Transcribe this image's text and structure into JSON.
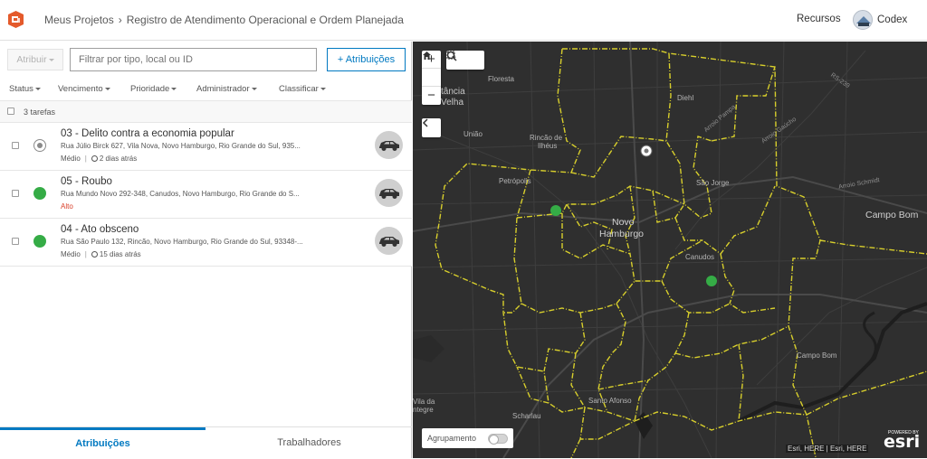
{
  "header": {
    "logo": "workforce-logo-icon",
    "breadcrumb_home": "Meus Projetos",
    "breadcrumb_sep": "›",
    "breadcrumb_current": "Registro de Atendimento Operacional e Ordem Planejada",
    "resources_label": "Recursos",
    "user_name": "Codex"
  },
  "toolbar": {
    "assign_label": "Atribuir",
    "filter_placeholder": "Filtrar por tipo, local ou ID",
    "add_label": "+ Atribuições"
  },
  "sort": {
    "status": "Status",
    "due": "Vencimento",
    "priority": "Prioridade",
    "admin": "Administrador",
    "sort": "Classificar"
  },
  "count_label": "3 tarefas",
  "tasks": [
    {
      "title": "03 - Delito contra a economia popular",
      "address": "Rua Júlio Birck 627, Vila Nova, Novo Hamburgo, Rio Grande do Sul, 935...",
      "priority": "Médio",
      "age": "2 dias atrás",
      "status_color": "#ffffff",
      "icon": "car-icon"
    },
    {
      "title": "05 - Roubo",
      "address": "Rua Mundo Novo 292-348, Canudos, Novo Hamburgo, Rio Grande do S...",
      "priority": "Alto",
      "age": "",
      "status_color": "#35ac46",
      "icon": "car-icon"
    },
    {
      "title": "04 - Ato obsceno",
      "address": "Rua São Paulo 132, Rincão, Novo Hamburgo, Rio Grande do Sul, 93348-...",
      "priority": "Médio",
      "age": "15 dias atrás",
      "status_color": "#35ac46",
      "icon": "car-icon"
    }
  ],
  "tabs": {
    "assignments": "Atribuições",
    "workers": "Trabalhadores"
  },
  "map": {
    "labels": {
      "estancia": "stância",
      "velha": "Velha",
      "floresta": "Floresta",
      "diehl": "Diehl",
      "uniao": "União",
      "rincao_ilheus_1": "Rincão de",
      "rincao_ilheus_2": "Ilhéus",
      "petropolis": "Petrópolis",
      "sao_jorge": "São Jorge",
      "novo_1": "Novo",
      "hamburgo": "Hamburgo",
      "canudos": "Canudos",
      "campo_bom": "Campo Bom",
      "campo_bom_small": "Campo Bom",
      "santo_afonso": "Santo Afonso",
      "scharlau": "Scharlau",
      "vila_da": "Vila da",
      "ntegre": "ntegre"
    },
    "road_labels": {
      "rs239": "RS-239",
      "arroio_pampa": "Arroio Pampa",
      "arroio_schmidt": "Arroio Schmidt",
      "arroio_gaucho": "Arroio Gaúcho"
    },
    "grouping_label": "Agrupamento",
    "attribution": "Esri, HERE | Esri, HERE",
    "powered": "POWERED BY",
    "esri": "esri",
    "boundary_color": "#d8cf2c",
    "point_color": "#35ac46"
  }
}
